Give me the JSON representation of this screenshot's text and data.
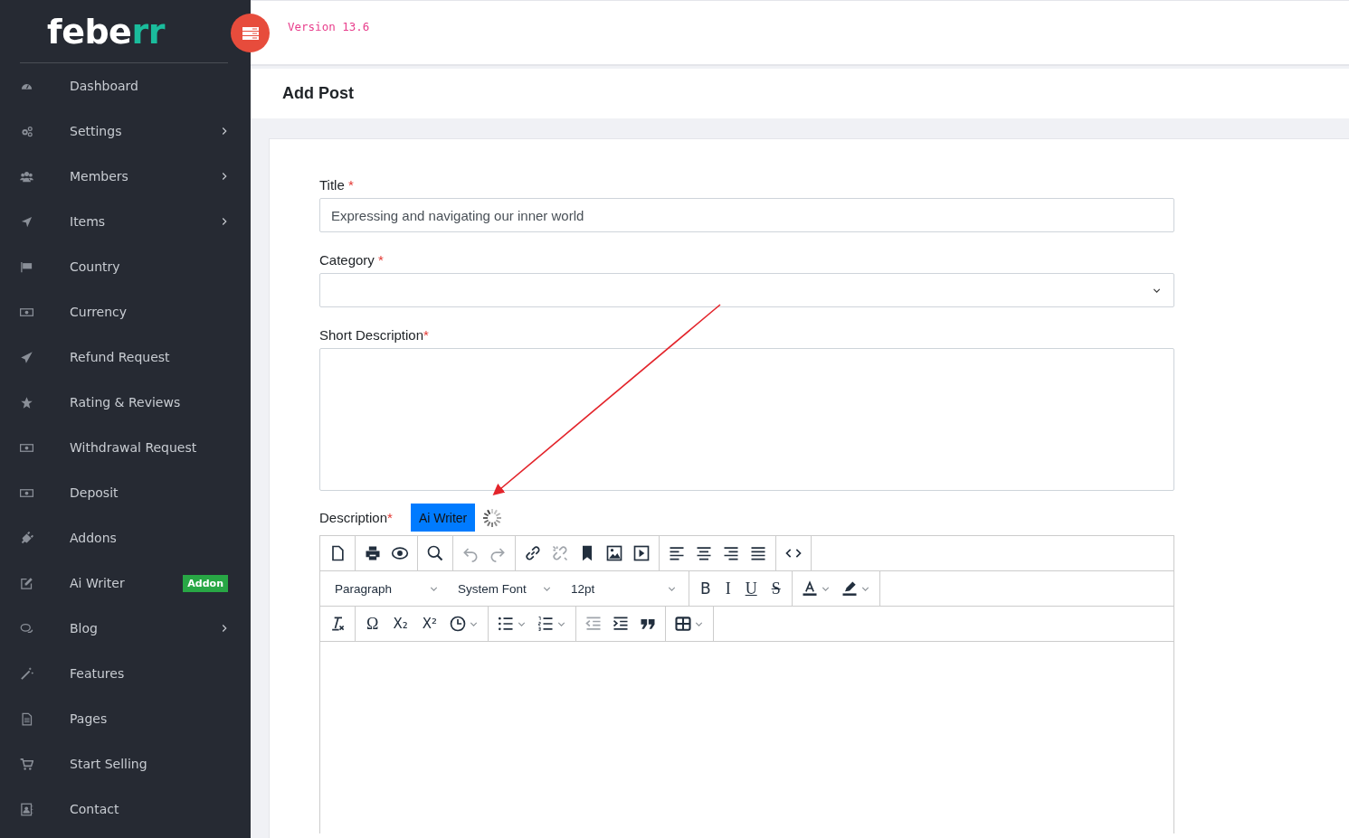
{
  "sidebar": {
    "logo": {
      "main": "febe",
      "accent": "rr"
    },
    "items": [
      {
        "kind": "gauge",
        "label": "Dashboard",
        "submenu": false
      },
      {
        "kind": "gears",
        "label": "Settings",
        "submenu": true
      },
      {
        "kind": "users",
        "label": "Members",
        "submenu": true
      },
      {
        "kind": "arrow",
        "label": "Items",
        "submenu": true
      },
      {
        "kind": "flag",
        "label": "Country",
        "submenu": false
      },
      {
        "kind": "money",
        "label": "Currency",
        "submenu": false
      },
      {
        "kind": "plane",
        "label": "Refund Request",
        "submenu": false
      },
      {
        "kind": "star",
        "label": "Rating & Reviews",
        "submenu": false
      },
      {
        "kind": "money",
        "label": "Withdrawal Request",
        "submenu": false
      },
      {
        "kind": "money",
        "label": "Deposit",
        "submenu": false
      },
      {
        "kind": "plug",
        "label": "Addons",
        "submenu": false
      },
      {
        "kind": "edit",
        "label": "Ai Writer",
        "submenu": false,
        "badge": "Addon"
      },
      {
        "kind": "chat",
        "label": "Blog",
        "submenu": true
      },
      {
        "kind": "wand",
        "label": "Features",
        "submenu": false
      },
      {
        "kind": "file",
        "label": "Pages",
        "submenu": false
      },
      {
        "kind": "cart",
        "label": "Start Selling",
        "submenu": false
      },
      {
        "kind": "contact",
        "label": "Contact",
        "submenu": false
      }
    ]
  },
  "topbar": {
    "version": "Version 13.6"
  },
  "page": {
    "title": "Add Post"
  },
  "form": {
    "title": {
      "label": "Title",
      "required_mark": "*",
      "value": "Expressing and navigating our inner world"
    },
    "category": {
      "label": "Category",
      "required_mark": "*"
    },
    "short_description": {
      "label": "Short Description",
      "required_mark": "*"
    },
    "description": {
      "label": "Description",
      "required_mark": "*",
      "ai_button": "Ai Writer",
      "loading": true
    }
  },
  "editor": {
    "toolbar": [
      {
        "groups": [
          {
            "items": [
              {
                "kind": "newdoc",
                "disabled": false
              }
            ]
          },
          {
            "items": [
              {
                "kind": "print",
                "disabled": false
              },
              {
                "kind": "preview",
                "disabled": false
              }
            ]
          },
          {
            "items": [
              {
                "kind": "search",
                "disabled": false
              }
            ]
          },
          {
            "items": [
              {
                "kind": "undo",
                "disabled": true
              },
              {
                "kind": "redo",
                "disabled": true
              }
            ]
          },
          {
            "items": [
              {
                "kind": "link",
                "disabled": false
              },
              {
                "kind": "unlink",
                "disabled": true
              },
              {
                "kind": "bookmark",
                "disabled": false
              },
              {
                "kind": "image",
                "disabled": false
              },
              {
                "kind": "media",
                "disabled": false
              }
            ]
          },
          {
            "items": [
              {
                "kind": "alignleft",
                "disabled": false
              },
              {
                "kind": "aligncenter",
                "disabled": false
              },
              {
                "kind": "alignright",
                "disabled": false
              },
              {
                "kind": "justify",
                "disabled": false
              }
            ]
          },
          {
            "items": [
              {
                "kind": "code",
                "disabled": false
              }
            ]
          }
        ]
      },
      {
        "groups": [
          {
            "items": [
              {
                "kind": "select",
                "value": "Paragraph"
              },
              {
                "kind": "select",
                "value": "System Font"
              },
              {
                "kind": "select",
                "value": "12pt"
              }
            ]
          },
          {
            "items": [
              {
                "kind": "bold",
                "label": "B",
                "disabled": false
              },
              {
                "kind": "italic",
                "label": "I",
                "disabled": false
              },
              {
                "kind": "underline",
                "label": "U",
                "disabled": false
              },
              {
                "kind": "strike",
                "label": "S",
                "disabled": false
              }
            ]
          },
          {
            "items": [
              {
                "kind": "forecolor",
                "disabled": false,
                "caret": true
              },
              {
                "kind": "highlight",
                "disabled": false,
                "caret": true
              }
            ]
          }
        ]
      },
      {
        "groups": [
          {
            "items": [
              {
                "kind": "clearformat",
                "disabled": false
              }
            ]
          },
          {
            "items": [
              {
                "kind": "glyph",
                "label": "Ω",
                "disabled": false
              },
              {
                "kind": "subscript",
                "label": "X₂",
                "disabled": false
              },
              {
                "kind": "superscript",
                "label": "X²",
                "disabled": false
              },
              {
                "kind": "time",
                "disabled": false,
                "caret": true
              }
            ]
          },
          {
            "items": [
              {
                "kind": "bullist",
                "disabled": false,
                "caret": true
              },
              {
                "kind": "numlist",
                "disabled": false,
                "caret": true
              }
            ]
          },
          {
            "items": [
              {
                "kind": "outdent",
                "disabled": true
              },
              {
                "kind": "indent",
                "disabled": false
              },
              {
                "kind": "quote",
                "disabled": false
              }
            ]
          },
          {
            "items": [
              {
                "kind": "table",
                "disabled": false,
                "caret": true
              }
            ]
          }
        ]
      }
    ]
  },
  "annotation": {
    "arrow": true
  }
}
